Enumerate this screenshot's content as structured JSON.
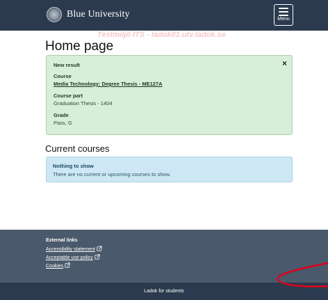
{
  "header": {
    "brand": "Blue University",
    "menu_label": "Menu"
  },
  "environment_banner": "Testmiljö ITS - ladok01.utv.ladok.se",
  "page_title": "Home page",
  "result_notification": {
    "heading": "New result",
    "course_label": "Course",
    "course_value": "Media Technology: Degree Thesis - ME127A",
    "course_part_label": "Course part",
    "course_part_value": "Graduation Thesis - 1404",
    "grade_label": "Grade",
    "grade_value": "Pass, G",
    "close_glyph": "×"
  },
  "current_courses": {
    "title": "Current courses",
    "notice_title": "Nothing to show",
    "notice_text": "There are no current or upcoming courses to show."
  },
  "footer": {
    "heading": "External links",
    "links": [
      "Accessibility statement",
      "Acceptable use policy",
      "Cookies"
    ]
  },
  "bottom_bar": "Ladok for students",
  "colors": {
    "header_bg": "#2b3a4e",
    "footer_bg": "#4b596c",
    "success_bg": "#d7eed9",
    "info_bg": "#cde7f4",
    "annotation": "#e0001b"
  }
}
